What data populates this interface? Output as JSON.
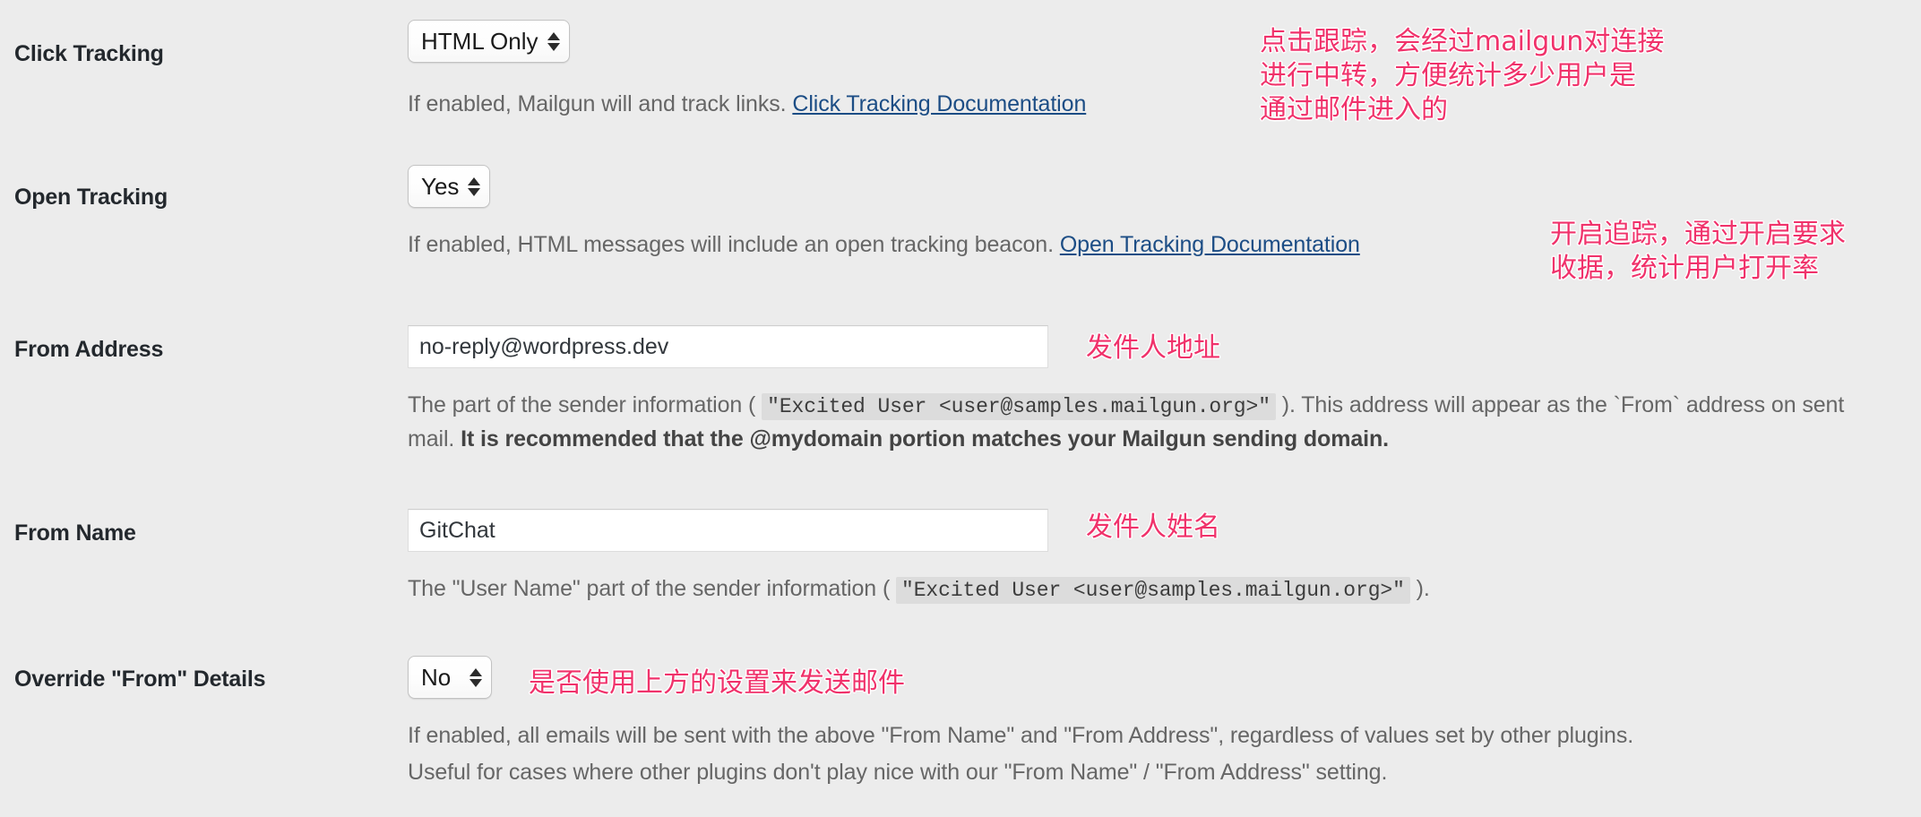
{
  "page": {
    "background_color": "#ececec",
    "annotation_color": "#f0326b",
    "link_color": "#1c4d85"
  },
  "rows": [
    {
      "label": "Click Tracking",
      "control": {
        "type": "select",
        "value": "HTML Only"
      },
      "description_prefix": "If enabled, Mailgun will and track links. ",
      "link_text": "Click Tracking Documentation"
    },
    {
      "label": "Open Tracking",
      "control": {
        "type": "select",
        "value": "Yes"
      },
      "description_prefix": "If enabled, HTML messages will include an open tracking beacon. ",
      "link_text": "Open Tracking Documentation"
    },
    {
      "label": "From Address",
      "control": {
        "type": "text",
        "value": "no-reply@wordpress.dev"
      },
      "desc_part_1": "The part of the sender information ( ",
      "desc_code_1": "\"Excited User <user@samples.mailgun.org>\"",
      "desc_part_2": " ). This address will appear as the `From` address on sent mail. ",
      "desc_bold": "It is recommended that the @mydomain portion matches your Mailgun sending domain."
    },
    {
      "label": "From Name",
      "control": {
        "type": "text",
        "value": "GitChat"
      },
      "desc_part_1": "The \"User Name\" part of the sender information ( ",
      "desc_code_1": "\"Excited User <user@samples.mailgun.org>\"",
      "desc_part_2": " )."
    },
    {
      "label": "Override \"From\" Details",
      "control": {
        "type": "select",
        "value": "No"
      },
      "desc_line_1": "If enabled, all emails will be sent with the above \"From Name\" and \"From Address\", regardless of values set by other plugins.",
      "desc_line_2": "Useful for cases where other plugins don't play nice with our \"From Name\" / \"From Address\" setting."
    }
  ],
  "annotations": [
    {
      "text": "点击跟踪，会经过mailgun对连接\n进行中转，方便统计多少用户是\n通过邮件进入的"
    },
    {
      "text": "开启追踪，通过开启要求\n收据，统计用户打开率"
    },
    {
      "text": "发件人地址"
    },
    {
      "text": "发件人姓名"
    },
    {
      "text": "是否使用上方的设置来发送邮件"
    }
  ]
}
